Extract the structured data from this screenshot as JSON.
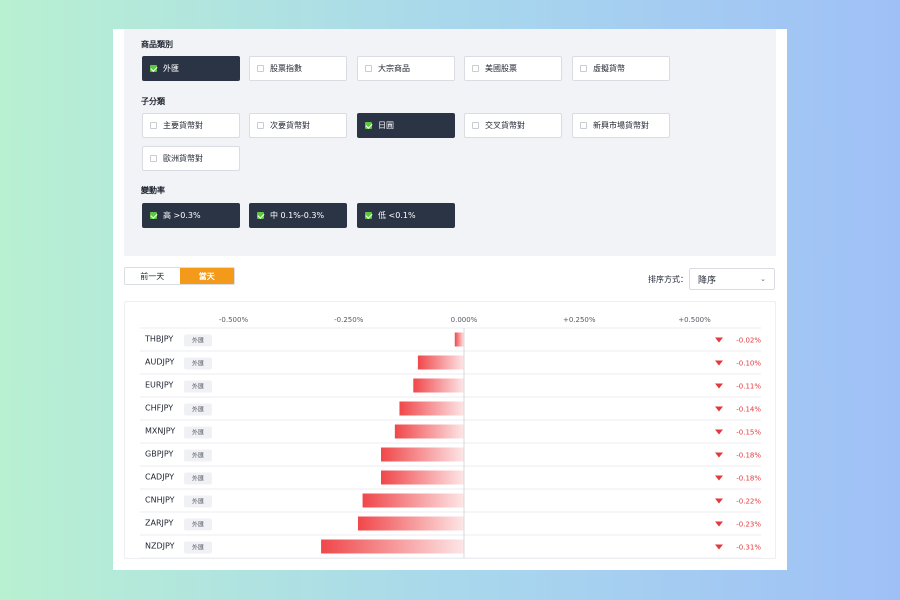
{
  "filters": {
    "category": {
      "label": "商品類別",
      "options": [
        {
          "label": "外匯",
          "active": true
        },
        {
          "label": "股票指數",
          "active": false
        },
        {
          "label": "大宗商品",
          "active": false
        },
        {
          "label": "美國股票",
          "active": false
        },
        {
          "label": "虛擬貨幣",
          "active": false
        }
      ]
    },
    "subcategory": {
      "label": "子分類",
      "options": [
        {
          "label": "主要貨幣對",
          "active": false
        },
        {
          "label": "次要貨幣對",
          "active": false
        },
        {
          "label": "日圓",
          "active": true
        },
        {
          "label": "交叉貨幣對",
          "active": false
        },
        {
          "label": "新興市場貨幣對",
          "active": false
        },
        {
          "label": "歐洲貨幣對",
          "active": false
        }
      ]
    },
    "volatility": {
      "label": "變動率",
      "options": [
        {
          "label": "高 >0.3%",
          "active": true
        },
        {
          "label": "中 0.1%-0.3%",
          "active": true
        },
        {
          "label": "低 <0.1%",
          "active": true
        }
      ]
    }
  },
  "day_toggle": {
    "prev_label": "前一天",
    "today_label": "當天",
    "active": "today"
  },
  "sort": {
    "label": "排序方式：",
    "value": "降序"
  },
  "colors": {
    "accent": "#f49a1a",
    "negative": "#e5383b",
    "active_chip": "#2b3445",
    "check": "#5cc83c"
  },
  "chart_data": {
    "type": "bar",
    "orientation": "horizontal",
    "x_ticks": [
      -0.5,
      -0.25,
      0,
      0.25,
      0.5
    ],
    "x_tick_labels": [
      "-0.500%",
      "-0.250%",
      "0.000%",
      "+0.250%",
      "+0.500%"
    ],
    "xlim": [
      -0.5,
      0.5
    ],
    "badge_label": "外匯",
    "rows": [
      {
        "symbol": "THBJPY",
        "value": -0.02,
        "label": "-0.02%"
      },
      {
        "symbol": "AUDJPY",
        "value": -0.1,
        "label": "-0.10%"
      },
      {
        "symbol": "EURJPY",
        "value": -0.11,
        "label": "-0.11%"
      },
      {
        "symbol": "CHFJPY",
        "value": -0.14,
        "label": "-0.14%"
      },
      {
        "symbol": "MXNJPY",
        "value": -0.15,
        "label": "-0.15%"
      },
      {
        "symbol": "GBPJPY",
        "value": -0.18,
        "label": "-0.18%"
      },
      {
        "symbol": "CADJPY",
        "value": -0.18,
        "label": "-0.18%"
      },
      {
        "symbol": "CNHJPY",
        "value": -0.22,
        "label": "-0.22%"
      },
      {
        "symbol": "ZARJPY",
        "value": -0.23,
        "label": "-0.23%"
      },
      {
        "symbol": "NZDJPY",
        "value": -0.31,
        "label": "-0.31%"
      }
    ]
  }
}
